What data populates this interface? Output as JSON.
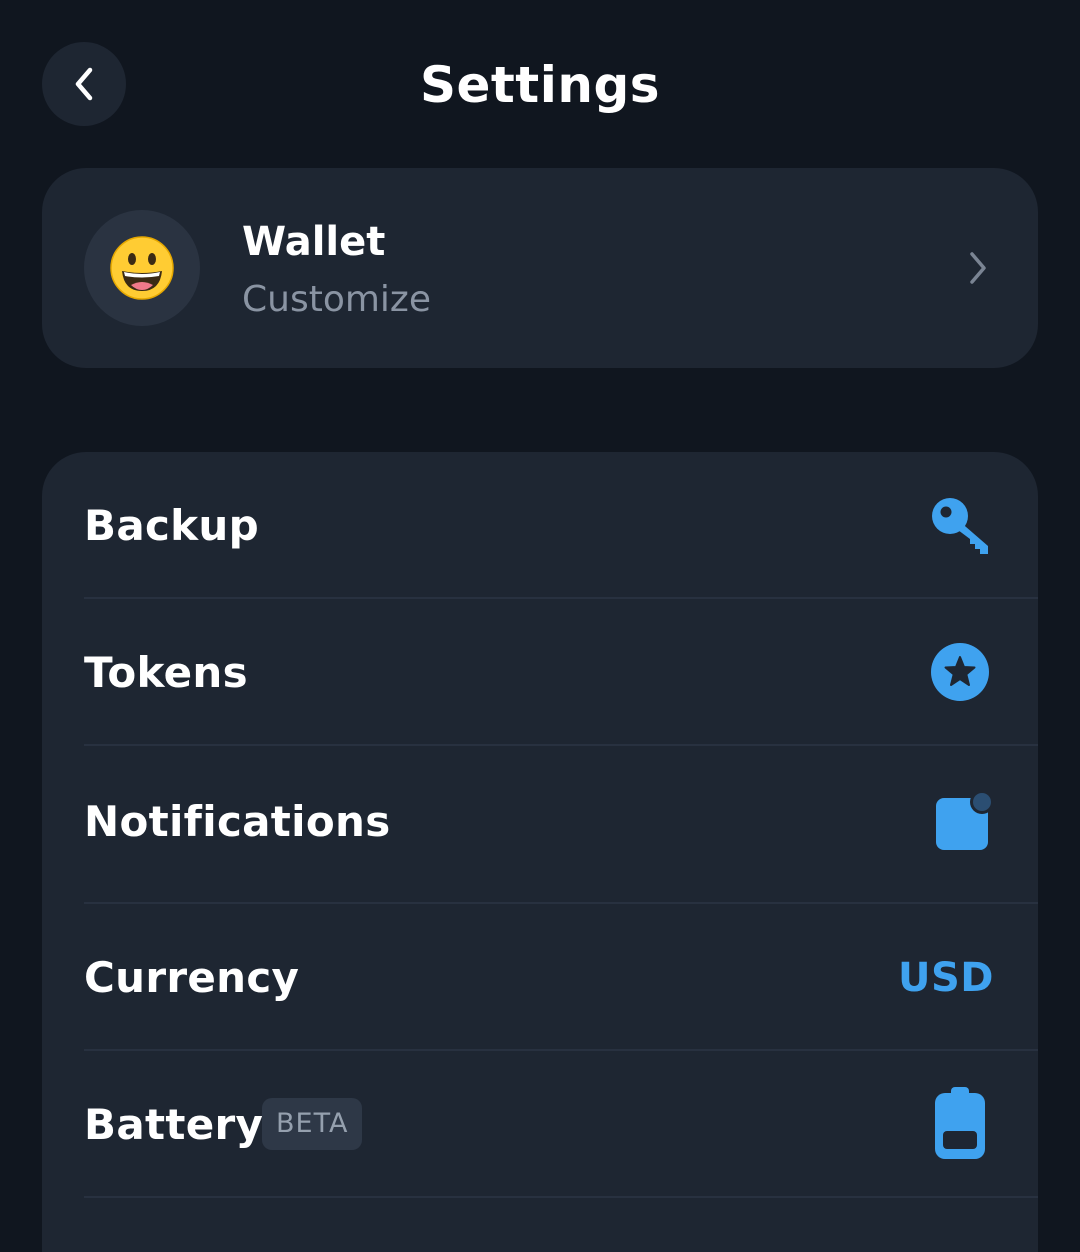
{
  "header": {
    "title": "Settings",
    "back_icon": "chevron-left-icon"
  },
  "wallet": {
    "emoji": "😀",
    "name": "Wallet",
    "subtitle": "Customize",
    "chevron_icon": "chevron-right-icon"
  },
  "settings": {
    "items": [
      {
        "label": "Backup",
        "icon": "key-icon"
      },
      {
        "label": "Tokens",
        "icon": "star-circle-icon"
      },
      {
        "label": "Notifications",
        "icon": "notification-badge-icon"
      },
      {
        "label": "Currency",
        "value": "USD"
      },
      {
        "label": "Battery",
        "badge": "BETA",
        "icon": "battery-icon"
      }
    ]
  },
  "colors": {
    "background": "#10161F",
    "card": "#1E2632",
    "accent": "#3FA2EF",
    "muted_text": "#8A94A3"
  }
}
